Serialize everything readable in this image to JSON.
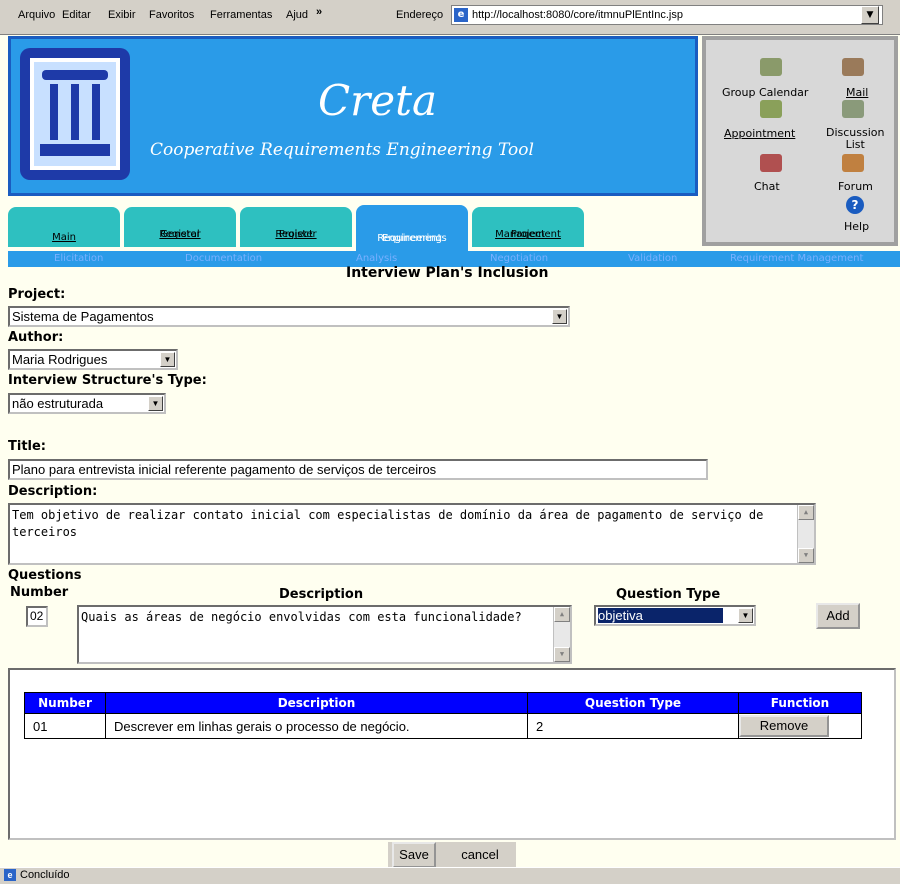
{
  "browser": {
    "menu": [
      "Arquivo",
      "Editar",
      "Exibir",
      "Favoritos",
      "Ferramentas",
      "Ajud"
    ],
    "overflow": "»",
    "address_label": "Endereço",
    "url": "http://localhost:8080/core/itmnuPlEntInc.jsp",
    "status": "Concluído"
  },
  "banner": {
    "title": "Creta",
    "subtitle": "Cooperative Requirements Engineering Tool"
  },
  "tools": {
    "group_calendar": "Group Calendar",
    "mail": "Mail",
    "appointment": "Appointment",
    "discussion_list_1": "Discussion",
    "discussion_list_2": "List",
    "chat": "Chat",
    "forum": "Forum",
    "help": "Help"
  },
  "tabs": {
    "main": "Main",
    "general_1": "General",
    "general_2": "Register",
    "project_1": "Project",
    "project_2": "Register",
    "req_1": "Requirements",
    "req_2": "Engineering",
    "mgmt_1": "Project",
    "mgmt_2": "Management"
  },
  "subnav": [
    "Elicitation",
    "Documentation",
    "Analysis",
    "Negotiation",
    "Validation",
    "Requirement Management"
  ],
  "page_title": "Interview Plan's Inclusion",
  "form": {
    "project_label": "Project:",
    "project_value": "Sistema de Pagamentos",
    "author_label": "Author:",
    "author_value": "Maria Rodrigues",
    "structure_label": "Interview Structure's Type:",
    "structure_value": "não estruturada",
    "title_label": "Title:",
    "title_value": "Plano para entrevista inicial referente pagamento de serviços de terceiros",
    "description_label": "Description:",
    "description_value": "Tem objetivo de realizar contato inicial com especialistas de domínio da área de pagamento de serviço de terceiros"
  },
  "questions": {
    "heading": "Questions",
    "number_header": "Number",
    "description_header": "Description",
    "type_header": "Question Type",
    "number_value": "02",
    "description_value": "Quais as áreas de negócio envolvidas com esta funcionalidade?",
    "type_value": "objetiva",
    "add_label": "Add"
  },
  "table": {
    "headers": [
      "Number",
      "Description",
      "Question Type",
      "Function"
    ],
    "rows": [
      {
        "number": "01",
        "description": "Descrever em linhas gerais o processo de negócio.",
        "type": "2",
        "action": "Remove"
      }
    ]
  },
  "actions": {
    "save": "Save",
    "cancel": "cancel"
  }
}
